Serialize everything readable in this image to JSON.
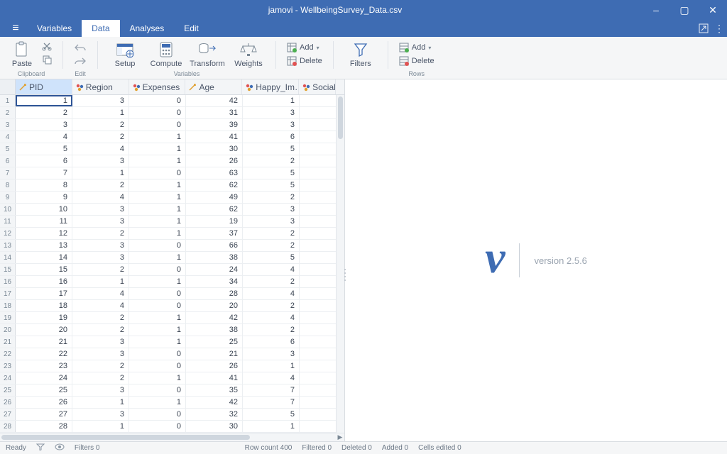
{
  "window": {
    "title": "jamovi - WellbeingSurvey_Data.csv"
  },
  "menu": {
    "items": [
      "Variables",
      "Data",
      "Analyses",
      "Edit"
    ],
    "active_index": 1
  },
  "ribbon": {
    "paste": "Paste",
    "clipboard_group": "Clipboard",
    "edit_group": "Edit",
    "setup": "Setup",
    "compute": "Compute",
    "transform": "Transform",
    "weights": "Weights",
    "variables_group": "Variables",
    "add": "Add",
    "delete": "Delete",
    "filters": "Filters",
    "rows_add": "Add",
    "rows_delete": "Delete",
    "rows_group": "Rows"
  },
  "columns": [
    {
      "name": "PID",
      "type": "continuous",
      "active": true
    },
    {
      "name": "Region",
      "type": "nominal"
    },
    {
      "name": "Expenses",
      "type": "nominal"
    },
    {
      "name": "Age",
      "type": "continuous"
    },
    {
      "name": "Happy_Im…",
      "type": "nominal"
    },
    {
      "name": "Social_S",
      "type": "nominal"
    }
  ],
  "rows": [
    [
      1,
      3,
      0,
      42,
      1
    ],
    [
      2,
      1,
      0,
      31,
      3
    ],
    [
      3,
      2,
      0,
      39,
      3
    ],
    [
      4,
      2,
      1,
      41,
      6
    ],
    [
      5,
      4,
      1,
      30,
      5
    ],
    [
      6,
      3,
      1,
      26,
      2
    ],
    [
      7,
      1,
      0,
      63,
      5
    ],
    [
      8,
      2,
      1,
      62,
      5
    ],
    [
      9,
      4,
      1,
      49,
      2
    ],
    [
      10,
      3,
      1,
      62,
      3
    ],
    [
      11,
      3,
      1,
      19,
      3
    ],
    [
      12,
      2,
      1,
      37,
      2
    ],
    [
      13,
      3,
      0,
      66,
      2
    ],
    [
      14,
      3,
      1,
      38,
      5
    ],
    [
      15,
      2,
      0,
      24,
      4
    ],
    [
      16,
      1,
      1,
      34,
      2
    ],
    [
      17,
      4,
      0,
      28,
      4
    ],
    [
      18,
      4,
      0,
      20,
      2
    ],
    [
      19,
      2,
      1,
      42,
      4
    ],
    [
      20,
      2,
      1,
      38,
      2
    ],
    [
      21,
      3,
      1,
      25,
      6
    ],
    [
      22,
      3,
      0,
      21,
      3
    ],
    [
      23,
      2,
      0,
      26,
      1
    ],
    [
      24,
      2,
      1,
      41,
      4
    ],
    [
      25,
      3,
      0,
      35,
      7
    ],
    [
      26,
      1,
      1,
      42,
      7
    ],
    [
      27,
      3,
      0,
      32,
      5
    ],
    [
      28,
      1,
      0,
      30,
      1
    ]
  ],
  "status": {
    "ready": "Ready",
    "filters": "Filters 0",
    "row_count": "Row count 400",
    "filtered": "Filtered 0",
    "deleted": "Deleted 0",
    "added": "Added 0",
    "cells_edited": "Cells edited 0"
  },
  "brand": {
    "version": "version 2.5.6"
  }
}
